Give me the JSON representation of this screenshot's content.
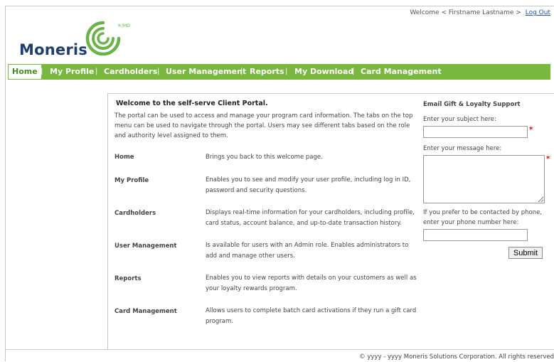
{
  "header": {
    "welcome_text": "Welcome < Firstname Lastname >",
    "logout_label": "Log Out"
  },
  "logo": {
    "name": "Moneris",
    "registered": "®/MD",
    "colors": {
      "text": "#1e3f6e",
      "mark": "#6bb24a"
    }
  },
  "nav": {
    "items": [
      {
        "label": "Home",
        "active": true
      },
      {
        "label": "My Profile"
      },
      {
        "label": "Cardholders"
      },
      {
        "label": "User Management"
      },
      {
        "label": "Reports"
      },
      {
        "label": "My Download"
      },
      {
        "label": "Card Management"
      }
    ],
    "separator": "|",
    "bar_color": "#79b73e"
  },
  "main": {
    "title": "Welcome to the self-serve Client Portal.",
    "description": "The portal can be used to access and manage your program card information. The tabs on the top menu can be used to navigate through the portal. Users may see different tabs based on the role and authority level assigned to them.",
    "rows": [
      {
        "label": "Home",
        "desc": "Brings you back to this welcome page."
      },
      {
        "label": "My Profile",
        "desc": "Enables you to see and modify your user profile, including log in ID, password and security questions."
      },
      {
        "label": "Cardholders",
        "desc": "Displays real-time information for your cardholders, including profile, card status, account balance, and up-to-date transaction history."
      },
      {
        "label": "User Management",
        "desc": "Is available for users with an Admin role. Enables administrators to add and manage other users."
      },
      {
        "label": "Reports",
        "desc": "Enables you to view reports with details on your customers as well as your loyalty rewards program."
      },
      {
        "label": "Card Management",
        "desc": "Allows users to complete batch card activations if they run a gift card program."
      }
    ]
  },
  "support": {
    "title": "Email Gift & Loyalty Support",
    "subject_label": "Enter your subject here:",
    "subject_value": "",
    "message_label": "Enter your message here:",
    "message_value": "",
    "phone_label": "If you prefer to be contacted by phone, enter your phone number here:",
    "phone_value": "",
    "required_marker": "*",
    "submit_label": "Submit"
  },
  "footer": {
    "copyright": "© yyyy - yyyy Moneris Solutions Corporation. All rights reserved"
  }
}
